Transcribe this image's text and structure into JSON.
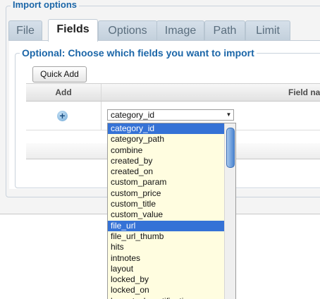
{
  "import_options": {
    "legend": "Import options",
    "tabs": [
      {
        "label": "File"
      },
      {
        "label": "Fields"
      },
      {
        "label": "Options"
      },
      {
        "label": "Image"
      },
      {
        "label": "Path"
      },
      {
        "label": "Limit"
      }
    ],
    "active_tab": "Fields"
  },
  "optional": {
    "legend": "Optional: Choose which fields you want to import",
    "quick_add_label": "Quick Add",
    "columns": {
      "add": "Add",
      "field_name": "Field na"
    }
  },
  "field_select": {
    "value": "category_id",
    "options": [
      "category_id",
      "category_path",
      "combine",
      "created_by",
      "created_on",
      "custom_param",
      "custom_price",
      "custom_title",
      "custom_value",
      "file_url",
      "file_url_thumb",
      "hits",
      "intnotes",
      "layout",
      "locked_by",
      "locked_on",
      "low_stock_notification"
    ],
    "highlighted": [
      "category_id",
      "file_url"
    ]
  },
  "colors": {
    "accent": "#1b66a8",
    "selection": "#3572d6",
    "dropdown_bg": "#fffde0"
  }
}
